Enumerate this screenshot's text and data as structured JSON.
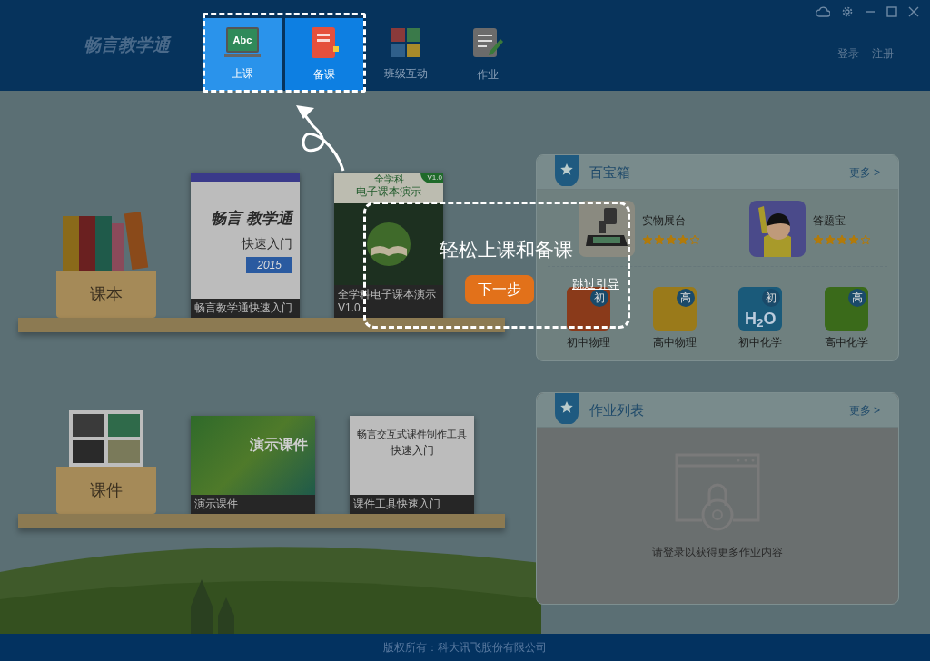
{
  "logo": {
    "text": "畅言教学通"
  },
  "nav": [
    {
      "label": "上课",
      "kind": "board",
      "icon_text": "Abc",
      "selected": true,
      "highlighted": true
    },
    {
      "label": "备课",
      "kind": "book",
      "selected": false,
      "highlighted": true
    },
    {
      "label": "班级互动",
      "kind": "blocks",
      "selected": false,
      "highlighted": false
    },
    {
      "label": "作业",
      "kind": "note",
      "selected": false,
      "highlighted": false
    }
  ],
  "account": [
    "登录",
    "注册"
  ],
  "shelves": [
    {
      "box_label": "课本",
      "kind": "books",
      "items": [
        {
          "kind": "intro",
          "cover_lines": [
            "畅言 教学通",
            "快速入门"
          ],
          "tag": "2015",
          "caption": "畅言教学通快速入门"
        },
        {
          "kind": "ebook",
          "badge": "V1.0",
          "cover_lines": [
            "全学科",
            "电子课本演示"
          ],
          "caption": "全学科电子课本演示V1.0"
        }
      ]
    },
    {
      "box_label": "课件",
      "kind": "photos",
      "items": [
        {
          "kind": "slides",
          "cover_lines": [
            "演示课件"
          ],
          "caption": "演示课件"
        },
        {
          "kind": "tool",
          "cover_lines": [
            "畅言交互式课件制作工具",
            "快速入门"
          ],
          "caption": "课件工具快速入门"
        }
      ]
    }
  ],
  "toolbox": {
    "title": "百宝箱",
    "more": "更多 >",
    "featured": [
      {
        "name": "实物展台",
        "stars": 4,
        "kind": "projector"
      },
      {
        "name": "答题宝",
        "stars": 4,
        "kind": "kid"
      }
    ],
    "apps": [
      {
        "name": "初中物理",
        "badge": "初",
        "kind": "circuit"
      },
      {
        "name": "高中物理",
        "badge": "高",
        "kind": "magnet"
      },
      {
        "name": "初中化学",
        "badge": "初",
        "kind": "water",
        "art_text": "H$_{2}$O"
      },
      {
        "name": "高中化学",
        "badge": "高",
        "kind": "flask"
      }
    ]
  },
  "homework": {
    "title": "作业列表",
    "more": "更多 >",
    "empty_text": "请登录以获得更多作业内容"
  },
  "guide": {
    "title": "轻松上课和备课",
    "next": "下一步",
    "skip": "跳过引导"
  },
  "footer": "版权所有：科大讯飞股份有限公司"
}
